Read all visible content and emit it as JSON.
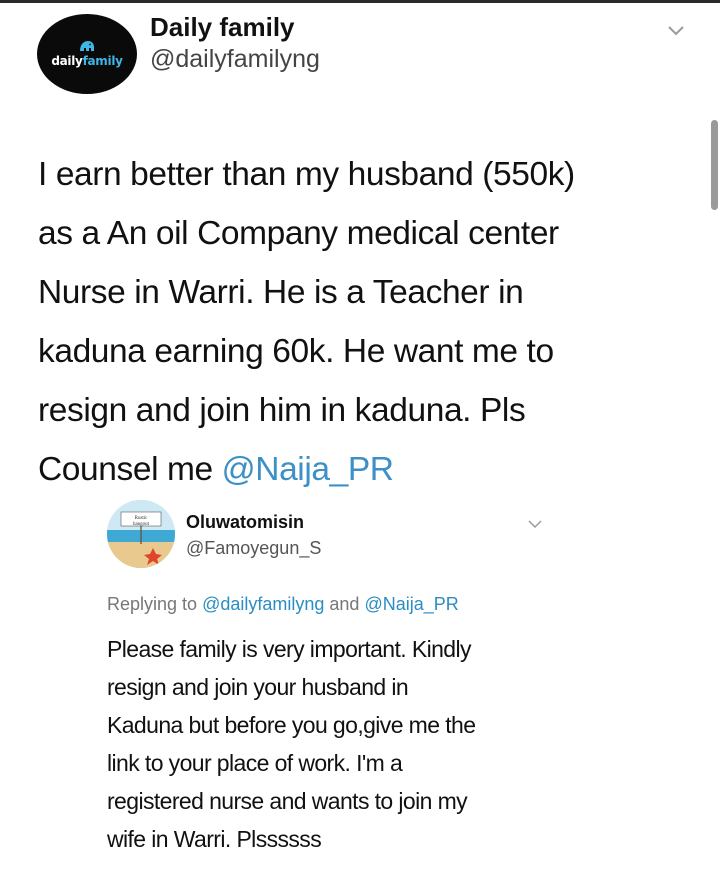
{
  "tweet": {
    "avatar": {
      "logo_left": "daily",
      "logo_right": "family",
      "icon": "elephant-logo-icon"
    },
    "display_name": "Daily family",
    "handle": "@dailyfamilyng",
    "menu_icon": "chevron-down-icon",
    "lines": [
      "I earn better than my husband (550k)",
      "as a An oil Company medical center",
      "Nurse in Warri. He is a Teacher in",
      "kaduna earning 60k. He want me to",
      "resign and join him in kaduna. Pls"
    ],
    "last_line_text": "Counsel me ",
    "last_line_mention": "@Naija_PR"
  },
  "reply": {
    "avatar_icon": "beach-hangout-logo-icon",
    "display_name": "Oluwatomisin",
    "handle": "@Famoyegun_S",
    "menu_icon": "chevron-down-icon",
    "replying_prefix": "Replying to ",
    "replying_mention_1": "@dailyfamilyng",
    "replying_and": " and ",
    "replying_mention_2": "@Naija_PR",
    "lines": [
      "Please family is very important. Kindly",
      "resign and join your husband in",
      "Kaduna but before you go,give me the",
      "link to your place of work. I'm a",
      "registered nurse and wants to join my",
      "wife in Warri. Plssssss"
    ]
  },
  "colors": {
    "link": "#3d8fc7",
    "logo_accent": "#3fb6e6",
    "avatar_bg": "#0a0a0a"
  }
}
